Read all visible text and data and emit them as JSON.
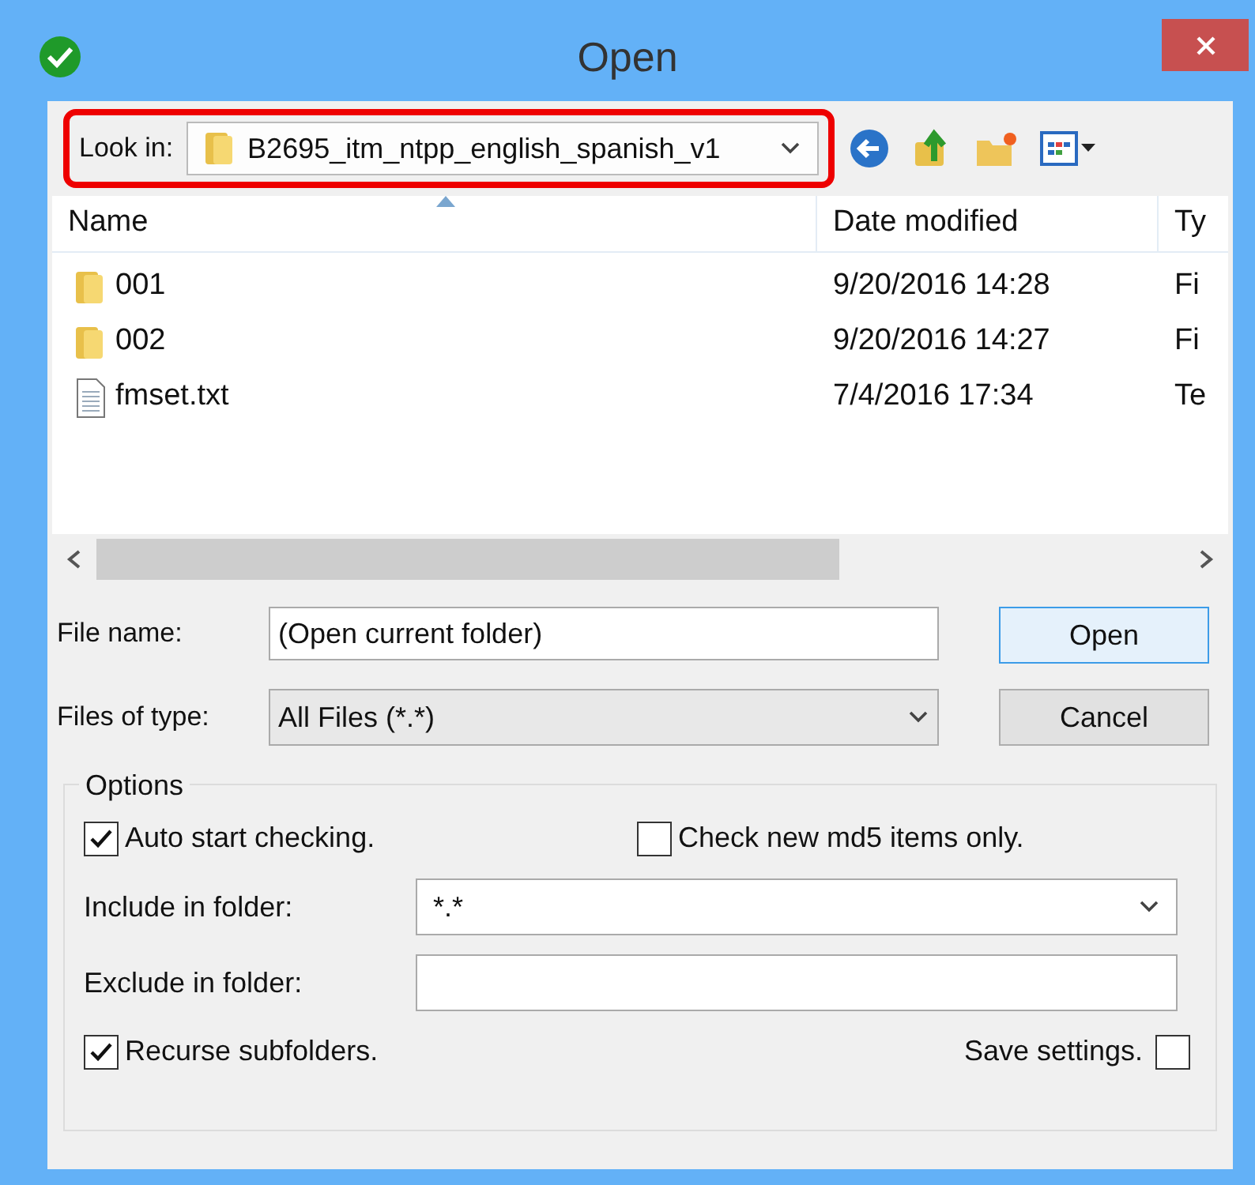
{
  "window": {
    "title": "Open"
  },
  "look_in": {
    "label": "Look in:",
    "value": "B2695_itm_ntpp_english_spanish_v1",
    "highlighted": true
  },
  "file_list": {
    "columns": [
      "Name",
      "Date modified",
      "Ty"
    ],
    "rows": [
      {
        "kind": "folder",
        "cells": [
          "001",
          "9/20/2016 14:28",
          "Fi"
        ]
      },
      {
        "kind": "folder",
        "cells": [
          "002",
          "9/20/2016 14:27",
          "Fi"
        ]
      },
      {
        "kind": "text-file",
        "cells": [
          "fmset.txt",
          "7/4/2016 17:34",
          "Te"
        ]
      }
    ]
  },
  "file_name": {
    "label": "File name:",
    "value": "(Open current folder)"
  },
  "file_type": {
    "label": "Files of type:",
    "value": "All Files (*.*)"
  },
  "buttons": [
    {
      "label": "Open",
      "default": true
    },
    {
      "label": "Cancel",
      "default": false
    }
  ],
  "options": {
    "title": "Options",
    "auto_start": {
      "label": "Auto start checking.",
      "checked": true
    },
    "md5_only": {
      "label": "Check new md5 items only.",
      "checked": false
    },
    "include": {
      "label": "Include in folder:",
      "value": "*.*"
    },
    "exclude": {
      "label": "Exclude in folder:"
    },
    "recurse": {
      "label": "Recurse subfolders.",
      "checked": true
    },
    "save": {
      "label": "Save settings.",
      "checked": false
    }
  }
}
